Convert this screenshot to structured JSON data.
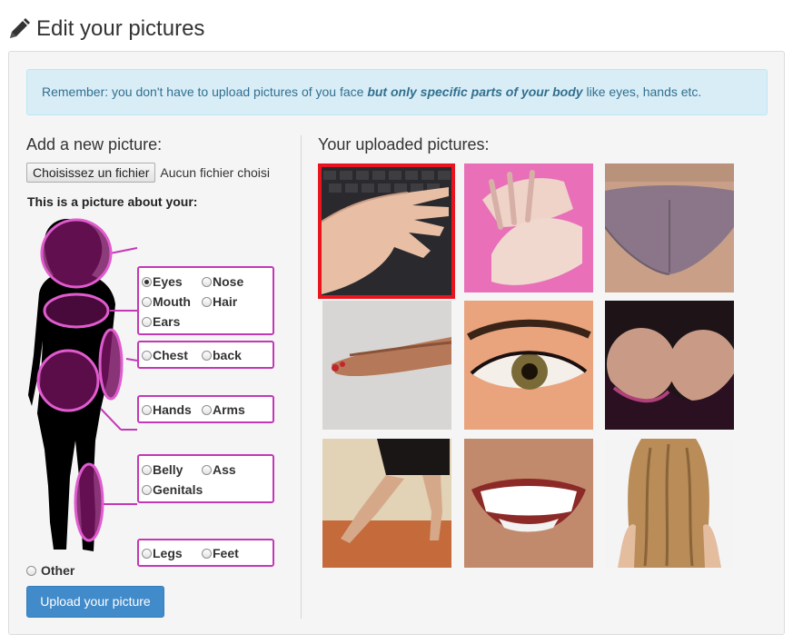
{
  "page": {
    "title": "Edit your pictures",
    "title_icon": "pencil-icon"
  },
  "alert": {
    "text_before": "Remember: you don't have to upload pictures of you face ",
    "emphasis": "but only specific parts of your body",
    "text_after": " like eyes, hands etc."
  },
  "add": {
    "title": "Add a new picture:",
    "file_button": "Choisissez un fichier",
    "file_status": "Aucun fichier choisi",
    "about_label": "This is a picture about your:",
    "options": {
      "eyes": "Eyes",
      "nose": "Nose",
      "mouth": "Mouth",
      "hair": "Hair",
      "ears": "Ears",
      "chest": "Chest",
      "back": "back",
      "hands": "Hands",
      "arms": "Arms",
      "belly": "Belly",
      "ass": "Ass",
      "genitals": "Genitals",
      "legs": "Legs",
      "feet": "Feet",
      "other": "Other"
    },
    "selected_option": "Eyes",
    "upload_button": "Upload your picture"
  },
  "uploaded": {
    "title": "Your uploaded pictures:",
    "pictures": [
      "hand on keyboard",
      "hands",
      "bottom",
      "feet",
      "eye",
      "chest",
      "legs",
      "smile",
      "hair"
    ],
    "selected_index": 0
  },
  "colors": {
    "accent": "#c438b6",
    "button": "#428bca",
    "alert_bg": "#d9edf7",
    "selected_border": "#e8141e"
  }
}
